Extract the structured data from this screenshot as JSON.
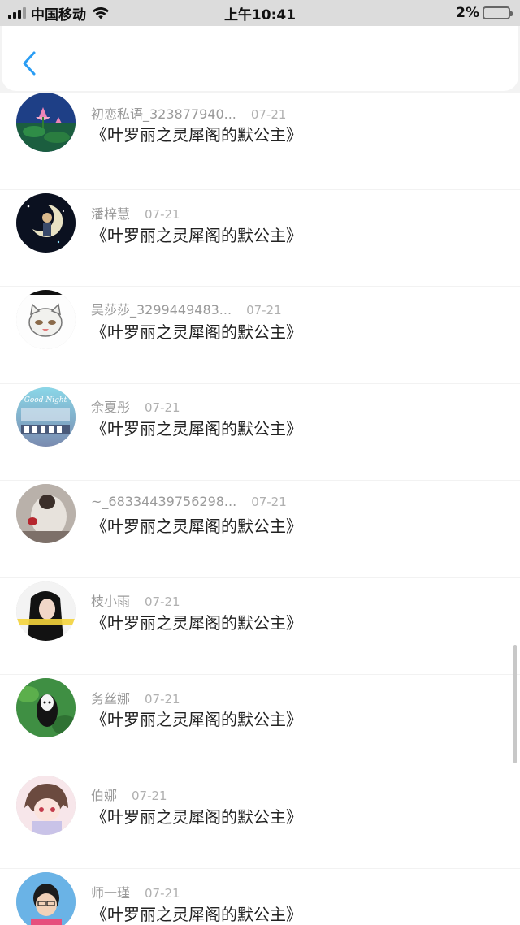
{
  "status_bar": {
    "carrier": "中国移动",
    "time": "上午10:41",
    "battery": "2%",
    "battery_color": "#e53935"
  },
  "nav": {
    "back_icon": "chevron-left-icon",
    "accent": "#2a9df4"
  },
  "items": [
    {
      "name": "初恋私语_323877940...",
      "date": "07-21",
      "title": "《叶罗丽之灵犀阁的默公主》"
    },
    {
      "name": "潘梓慧",
      "date": "07-21",
      "title": "《叶罗丽之灵犀阁的默公主》"
    },
    {
      "name": "吴莎莎_3299449483...",
      "date": "07-21",
      "title": "《叶罗丽之灵犀阁的默公主》"
    },
    {
      "name": "余夏彤",
      "date": "07-21",
      "title": "《叶罗丽之灵犀阁的默公主》"
    },
    {
      "name": "~_68334439756298...",
      "date": "07-21",
      "title": "《叶罗丽之灵犀阁的默公主》"
    },
    {
      "name": "枝小雨",
      "date": "07-21",
      "title": "《叶罗丽之灵犀阁的默公主》"
    },
    {
      "name": "务丝娜",
      "date": "07-21",
      "title": "《叶罗丽之灵犀阁的默公主》"
    },
    {
      "name": "伯娜",
      "date": "07-21",
      "title": "《叶罗丽之灵犀阁的默公主》"
    },
    {
      "name": "师一瑾",
      "date": "07-21",
      "title": "《叶罗丽之灵犀阁的默公主》"
    }
  ],
  "avatar_good_night_text": "Good Night"
}
